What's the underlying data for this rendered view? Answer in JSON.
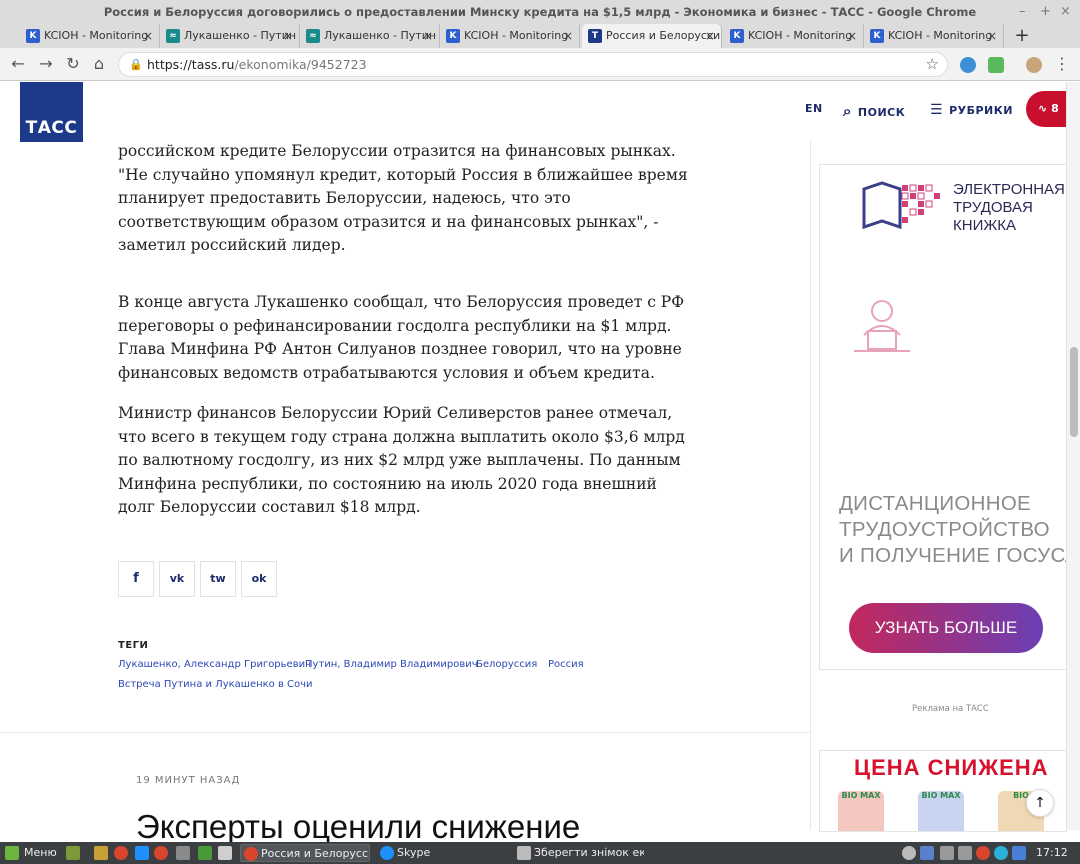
{
  "window": {
    "title": "Россия и Белоруссия договорились о предоставлении Минску кредита на $1,5 млрд - Экономика и бизнес - ТАСС - Google Chrome",
    "controls": [
      "–",
      "+",
      "×"
    ]
  },
  "tabs": [
    {
      "label": "KCIOH - Monitoring",
      "favicon": "K",
      "color": "#2f5fcf"
    },
    {
      "label": "Лукашенко - Путин",
      "favicon": "≈",
      "color": "#1b8a8c"
    },
    {
      "label": "Лукашенко - Путин",
      "favicon": "≈",
      "color": "#1b8a8c"
    },
    {
      "label": "KCIOH - Monitoring",
      "favicon": "K",
      "color": "#2f5fcf"
    },
    {
      "label": "Россия и Белоруссия",
      "favicon": "T",
      "color": "#1d3a8a"
    },
    {
      "label": "KCIOH - Monitoring",
      "favicon": "K",
      "color": "#2f5fcf"
    },
    {
      "label": "KCIOH - Monitoring",
      "favicon": "K",
      "color": "#2f5fcf"
    }
  ],
  "tab_close": "×",
  "new_tab": "+",
  "address": {
    "host": "https://tass.ru",
    "path": "/ekonomika/9452723"
  },
  "site": {
    "logo": "ТАСС",
    "lang": "EN",
    "search": "ПОИСК",
    "rubrics": "РУБРИКИ",
    "live_count": "8"
  },
  "article": {
    "paragraphs": [
      "российском кредите Белоруссии отразится на финансовых рынках. \"Не случайно упомянул кредит, который Россия в ближайшее время планирует предоставить Белоруссии, надеюсь, что это соответствующим образом отразится и на финансовых рынках\", - заметил российский лидер.",
      "В конце августа Лукашенко сообщал, что Белоруссия проведет с РФ переговоры о рефинансировании госдолга республики на $1 млрд. Глава Минфина РФ Антон Силуанов позднее говорил, что на уровне финансовых ведомств отрабатываются условия и объем кредита.",
      "Министр финансов Белоруссии Юрий Селиверстов ранее отмечал, что всего в текущем году страна должна выплатить около $3,6 млрд по валютному госдолгу, из них $2 млрд уже выплачены. По данным Минфина республики, по состоянию на июль 2020 года внешний долг Белоруссии составил $18 млрд."
    ]
  },
  "share": [
    "f",
    "vk",
    "tw",
    "ok"
  ],
  "tags": {
    "title": "ТЕГИ",
    "items": [
      "Лукашенко, Александр Григорьевич",
      "Путин, Владимир Владимирович",
      "Белоруссия",
      "Россия",
      "Встреча Путина и Лукашенко в Сочи"
    ]
  },
  "next": {
    "time": "19 МИНУТ НАЗАД",
    "title": "Эксперты оценили снижение"
  },
  "ad": {
    "title": [
      "ЭЛЕКТРОННАЯ",
      "ТРУДОВАЯ",
      "КНИЖКА"
    ],
    "body": [
      "ДИСТАНЦИОННОЕ",
      "ТРУДОУСТРОЙСТВО",
      "И ПОЛУЧЕНИЕ ГОСУСЛУГ"
    ],
    "button": "УЗНАТЬ БОЛЬШЕ",
    "caption": "Реклама на ТАСС"
  },
  "ad2": {
    "title": "ЦЕНА СНИЖЕНА",
    "products": [
      "BIO MAX",
      "BIO MAX",
      "BIO"
    ]
  },
  "taskbar": {
    "menu": "Меню",
    "windows": [
      "Россия и Белорусс...",
      "Skype",
      "Зберегти знімок ек..."
    ],
    "clock": "17:12"
  }
}
